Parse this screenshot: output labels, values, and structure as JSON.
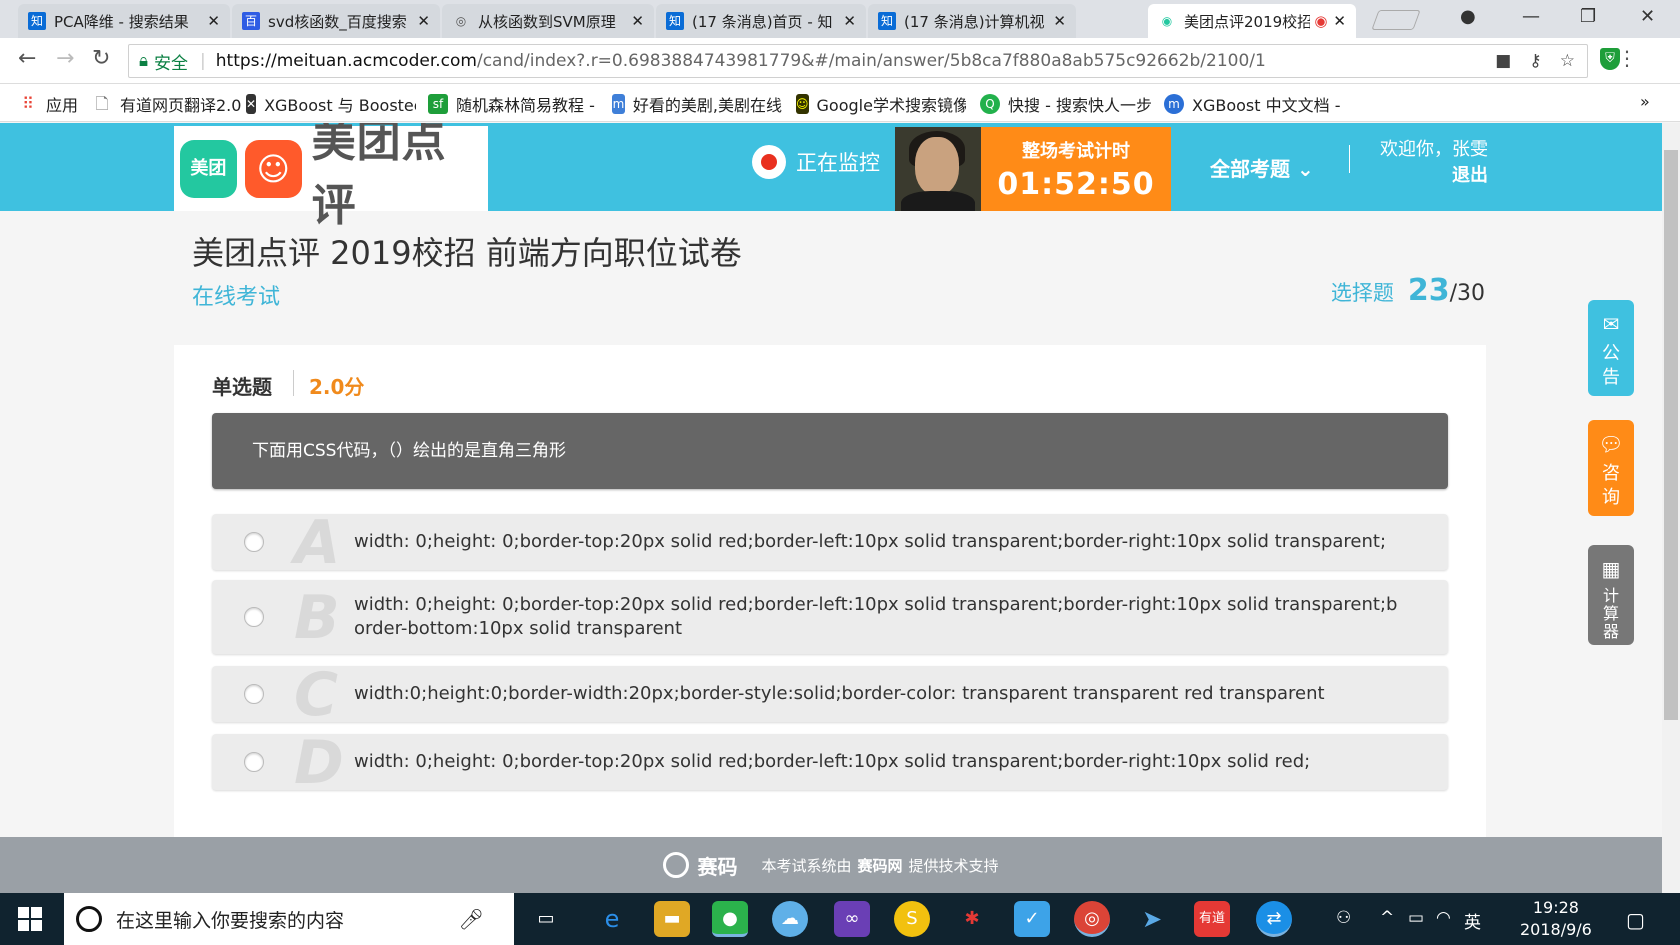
{
  "browser": {
    "tabs": [
      {
        "favicon": "知",
        "title": "PCA降维 - 搜索结果",
        "icon_color": "#0a6cd6"
      },
      {
        "favicon": "百",
        "title": "svd核函数_百度搜索",
        "icon_color": "#2f5ce4"
      },
      {
        "favicon": "◎",
        "title": "从核函数到SVM原理",
        "icon_color": "#555555"
      },
      {
        "favicon": "知",
        "title": "(17 条消息)首页 - 知",
        "icon_color": "#0a6cd6"
      },
      {
        "favicon": "知",
        "title": "(17 条消息)计算机视",
        "icon_color": "#0a6cd6"
      },
      {
        "favicon": "◉",
        "title": "美团点评2019校招",
        "icon_color": "#23c8a0"
      }
    ],
    "address": {
      "secure_label": "安全",
      "url_host": "https://meituan.acmcoder.com",
      "url_path": "/cand/index?.r=0.6983884743981779&#/main/answer/5b8ca7f880a8ab575c92662b/2100/1"
    },
    "bookmarks": [
      {
        "label": "应用",
        "icon": "apps-icon",
        "color": "#e84335"
      },
      {
        "label": "有道网页翻译2.0",
        "icon": "page-icon",
        "color": "#888888"
      },
      {
        "label": "XGBoost 与 Boostec",
        "icon": "xgb-icon",
        "color": "#333333"
      },
      {
        "label": "随机森林简易教程 - ",
        "icon": "sf-icon",
        "color": "#1e9e3a"
      },
      {
        "label": "好看的美剧,美剧在线",
        "icon": "tv-icon",
        "color": "#3f7fd8"
      },
      {
        "label": "Google学术搜索镜像",
        "icon": "scholar-icon",
        "color": "#333300"
      },
      {
        "label": "快搜 - 搜索快人一步",
        "icon": "kuaisou-icon",
        "color": "#22b14c"
      },
      {
        "label": "XGBoost 中文文档 -",
        "icon": "m-icon",
        "color": "#2b6fd6"
      }
    ],
    "bookmarks_more": "»"
  },
  "header": {
    "logo_badge": "美团",
    "logo_text": "美团点评",
    "monitor_label": "正在监控",
    "timer_label": "整场考试计时",
    "timer_value": "01:52:50",
    "all_questions": "全部考题",
    "welcome": "欢迎你，张雯",
    "logout": "退出"
  },
  "exam": {
    "title": "美团点评 2019校招 前端方向职位试卷",
    "subtitle": "在线考试",
    "progress_label": "选择题",
    "progress_current": "23",
    "progress_total": "/30"
  },
  "question": {
    "type": "单选题",
    "score": "2.0分",
    "text": "下面用CSS代码，（）绘出的是直角三角形",
    "options": [
      {
        "letter": "A",
        "text": "width: 0;height: 0;border-top:20px solid red;border-left:10px solid transparent;border-right:10px solid transparent;"
      },
      {
        "letter": "B",
        "text": "width: 0;height: 0;border-top:20px solid red;border-left:10px solid transparent;border-right:10px solid transparent;border-bottom:10px solid transparent"
      },
      {
        "letter": "C",
        "text": "width:0;height:0;border-width:20px;border-style:solid;border-color: transparent transparent red transparent"
      },
      {
        "letter": "D",
        "text": "width: 0;height: 0;border-top:20px solid red;border-left:10px solid transparent;border-right:10px solid red;"
      }
    ]
  },
  "side_tools": [
    {
      "label_1": "公",
      "label_2": "告",
      "icon": "mail-icon",
      "color": "#3fc1e0"
    },
    {
      "label_1": "咨",
      "label_2": "询",
      "icon": "chat-icon",
      "color": "#ff8b17"
    },
    {
      "label_1": "计",
      "label_2": "算",
      "label_3": "器",
      "icon": "calculator-icon",
      "color": "#777777"
    }
  ],
  "footer": {
    "brand": "赛码",
    "text_before": "本考试系统由",
    "text_brand": "赛码网",
    "text_after": "提供技术支持"
  },
  "taskbar": {
    "search_placeholder": "在这里输入你要搜索的内容",
    "ime": "英",
    "time": "19:28",
    "date": "2018/9/6"
  }
}
